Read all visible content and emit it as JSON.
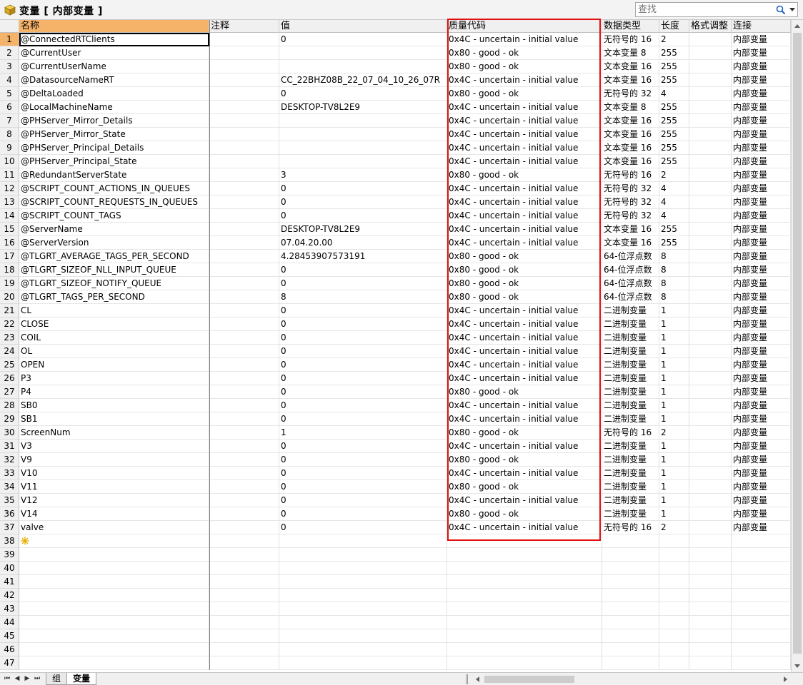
{
  "window": {
    "title": "变量 [ 内部变量 ]",
    "icon": "variable-cube-icon"
  },
  "search": {
    "placeholder": "查找",
    "icon": "search-icon"
  },
  "columns": [
    "名称",
    "注释",
    "值",
    "质量代码",
    "数据类型",
    "长度",
    "格式调整",
    "连接"
  ],
  "rows": [
    [
      "@ConnectedRTClients",
      "",
      "0",
      "0x4C - uncertain - initial value",
      "无符号的 16",
      "2",
      "",
      "内部变量"
    ],
    [
      "@CurrentUser",
      "",
      "",
      "0x80 - good - ok",
      "文本变量 8",
      "255",
      "",
      "内部变量"
    ],
    [
      "@CurrentUserName",
      "",
      "",
      "0x80 - good - ok",
      "文本变量 16",
      "255",
      "",
      "内部变量"
    ],
    [
      "@DatasourceNameRT",
      "",
      "CC_22BHZ08B_22_07_04_10_26_07R",
      "0x4C - uncertain - initial value",
      "文本变量 16",
      "255",
      "",
      "内部变量"
    ],
    [
      "@DeltaLoaded",
      "",
      "0",
      "0x80 - good - ok",
      "无符号的 32",
      "4",
      "",
      "内部变量"
    ],
    [
      "@LocalMachineName",
      "",
      "DESKTOP-TV8L2E9",
      "0x4C - uncertain - initial value",
      "文本变量 8",
      "255",
      "",
      "内部变量"
    ],
    [
      "@PHServer_Mirror_Details",
      "",
      "",
      "0x4C - uncertain - initial value",
      "文本变量 16",
      "255",
      "",
      "内部变量"
    ],
    [
      "@PHServer_Mirror_State",
      "",
      "",
      "0x4C - uncertain - initial value",
      "文本变量 16",
      "255",
      "",
      "内部变量"
    ],
    [
      "@PHServer_Principal_Details",
      "",
      "",
      "0x4C - uncertain - initial value",
      "文本变量 16",
      "255",
      "",
      "内部变量"
    ],
    [
      "@PHServer_Principal_State",
      "",
      "",
      "0x4C - uncertain - initial value",
      "文本变量 16",
      "255",
      "",
      "内部变量"
    ],
    [
      "@RedundantServerState",
      "",
      "3",
      "0x80 - good - ok",
      "无符号的 16",
      "2",
      "",
      "内部变量"
    ],
    [
      "@SCRIPT_COUNT_ACTIONS_IN_QUEUES",
      "",
      "0",
      "0x4C - uncertain - initial value",
      "无符号的 32",
      "4",
      "",
      "内部变量"
    ],
    [
      "@SCRIPT_COUNT_REQUESTS_IN_QUEUES",
      "",
      "0",
      "0x4C - uncertain - initial value",
      "无符号的 32",
      "4",
      "",
      "内部变量"
    ],
    [
      "@SCRIPT_COUNT_TAGS",
      "",
      "0",
      "0x4C - uncertain - initial value",
      "无符号的 32",
      "4",
      "",
      "内部变量"
    ],
    [
      "@ServerName",
      "",
      "DESKTOP-TV8L2E9",
      "0x4C - uncertain - initial value",
      "文本变量 16",
      "255",
      "",
      "内部变量"
    ],
    [
      "@ServerVersion",
      "",
      "07.04.20.00",
      "0x4C - uncertain - initial value",
      "文本变量 16",
      "255",
      "",
      "内部变量"
    ],
    [
      "@TLGRT_AVERAGE_TAGS_PER_SECOND",
      "",
      "4.28453907573191",
      "0x80 - good - ok",
      "64-位浮点数",
      "8",
      "",
      "内部变量"
    ],
    [
      "@TLGRT_SIZEOF_NLL_INPUT_QUEUE",
      "",
      "0",
      "0x80 - good - ok",
      "64-位浮点数",
      "8",
      "",
      "内部变量"
    ],
    [
      "@TLGRT_SIZEOF_NOTIFY_QUEUE",
      "",
      "0",
      "0x80 - good - ok",
      "64-位浮点数",
      "8",
      "",
      "内部变量"
    ],
    [
      "@TLGRT_TAGS_PER_SECOND",
      "",
      "8",
      "0x80 - good - ok",
      "64-位浮点数",
      "8",
      "",
      "内部变量"
    ],
    [
      "CL",
      "",
      "0",
      "0x4C - uncertain - initial value",
      "二进制变量",
      "1",
      "",
      "内部变量"
    ],
    [
      "CLOSE",
      "",
      "0",
      "0x4C - uncertain - initial value",
      "二进制变量",
      "1",
      "",
      "内部变量"
    ],
    [
      "COIL",
      "",
      "0",
      "0x4C - uncertain - initial value",
      "二进制变量",
      "1",
      "",
      "内部变量"
    ],
    [
      "OL",
      "",
      "0",
      "0x4C - uncertain - initial value",
      "二进制变量",
      "1",
      "",
      "内部变量"
    ],
    [
      "OPEN",
      "",
      "0",
      "0x4C - uncertain - initial value",
      "二进制变量",
      "1",
      "",
      "内部变量"
    ],
    [
      "P3",
      "",
      "0",
      "0x4C - uncertain - initial value",
      "二进制变量",
      "1",
      "",
      "内部变量"
    ],
    [
      "P4",
      "",
      "0",
      "0x80 - good - ok",
      "二进制变量",
      "1",
      "",
      "内部变量"
    ],
    [
      "SB0",
      "",
      "0",
      "0x4C - uncertain - initial value",
      "二进制变量",
      "1",
      "",
      "内部变量"
    ],
    [
      "SB1",
      "",
      "0",
      "0x4C - uncertain - initial value",
      "二进制变量",
      "1",
      "",
      "内部变量"
    ],
    [
      "ScreenNum",
      "",
      "1",
      "0x80 - good - ok",
      "无符号的 16",
      "2",
      "",
      "内部变量"
    ],
    [
      "V3",
      "",
      "0",
      "0x4C - uncertain - initial value",
      "二进制变量",
      "1",
      "",
      "内部变量"
    ],
    [
      "V9",
      "",
      "0",
      "0x80 - good - ok",
      "二进制变量",
      "1",
      "",
      "内部变量"
    ],
    [
      "V10",
      "",
      "0",
      "0x4C - uncertain - initial value",
      "二进制变量",
      "1",
      "",
      "内部变量"
    ],
    [
      "V11",
      "",
      "0",
      "0x80 - good - ok",
      "二进制变量",
      "1",
      "",
      "内部变量"
    ],
    [
      "V12",
      "",
      "0",
      "0x4C - uncertain - initial value",
      "二进制变量",
      "1",
      "",
      "内部变量"
    ],
    [
      "V14",
      "",
      "0",
      "0x80 - good - ok",
      "二进制变量",
      "1",
      "",
      "内部变量"
    ],
    [
      "valve",
      "",
      "0",
      "0x4C - uncertain - initial value",
      "无符号的 16",
      "2",
      "",
      "内部变量"
    ]
  ],
  "total_row_numbers": 47,
  "new_row_icon": "new-row-star-icon",
  "sheet_tabs": [
    "组",
    "变量"
  ],
  "active_sheet": "变量",
  "colors": {
    "selection_header": "#f5b36a",
    "highlight_box": "#e01010"
  }
}
